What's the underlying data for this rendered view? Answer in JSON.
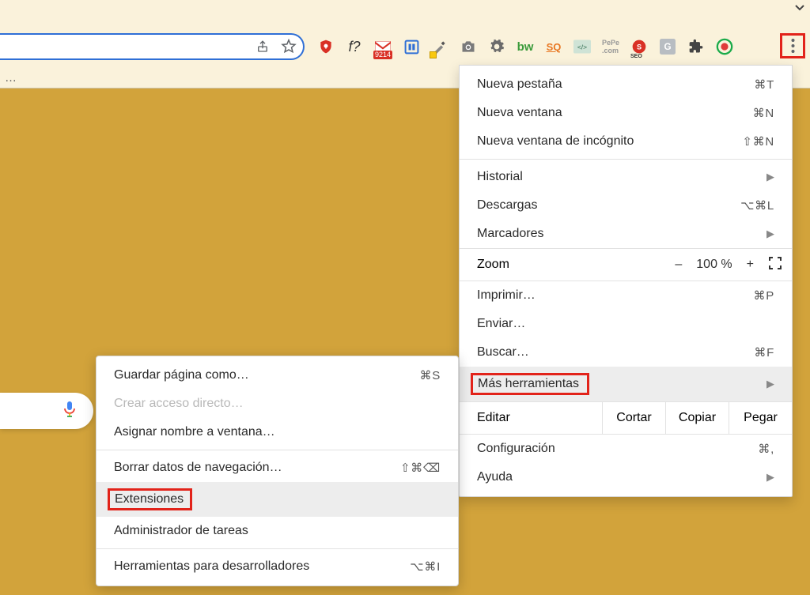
{
  "toolbar": {
    "gmail_badge": "9214"
  },
  "main_menu": {
    "new_tab": {
      "label": "Nueva pestaña",
      "shortcut": "⌘T"
    },
    "new_window": {
      "label": "Nueva ventana",
      "shortcut": "⌘N"
    },
    "incognito": {
      "label": "Nueva ventana de incógnito",
      "shortcut": "⇧⌘N"
    },
    "history": {
      "label": "Historial"
    },
    "downloads": {
      "label": "Descargas",
      "shortcut": "⌥⌘L"
    },
    "bookmarks": {
      "label": "Marcadores"
    },
    "zoom": {
      "label": "Zoom",
      "minus": "–",
      "value": "100 %",
      "plus": "+"
    },
    "print": {
      "label": "Imprimir…",
      "shortcut": "⌘P"
    },
    "cast": {
      "label": "Enviar…"
    },
    "find": {
      "label": "Buscar…",
      "shortcut": "⌘F"
    },
    "more_tools": {
      "label": "Más herramientas"
    },
    "edit": {
      "label": "Editar",
      "cut": "Cortar",
      "copy": "Copiar",
      "paste": "Pegar"
    },
    "settings": {
      "label": "Configuración",
      "shortcut": "⌘,"
    },
    "help": {
      "label": "Ayuda"
    }
  },
  "sub_menu": {
    "save_page": {
      "label": "Guardar página como…",
      "shortcut": "⌘S"
    },
    "create_shortcut": {
      "label": "Crear acceso directo…"
    },
    "name_window": {
      "label": "Asignar nombre a ventana…"
    },
    "clear_data": {
      "label": "Borrar datos de navegación…",
      "shortcut": "⇧⌘⌫"
    },
    "extensions": {
      "label": "Extensiones"
    },
    "task_manager": {
      "label": "Administrador de tareas"
    },
    "dev_tools": {
      "label": "Herramientas para desarrolladores",
      "shortcut": "⌥⌘I"
    }
  }
}
